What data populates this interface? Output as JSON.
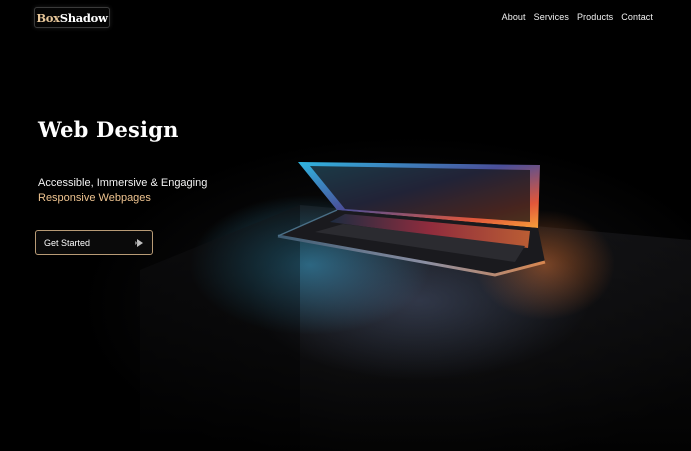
{
  "brand": {
    "logo_part1": "Box",
    "logo_part2": "Shadow"
  },
  "nav": {
    "items": [
      "About",
      "Services",
      "Products",
      "Contact"
    ]
  },
  "hero": {
    "title": "Web Design",
    "line1": "Accessible, Immersive & Engaging",
    "line2": "Responsive Webpages",
    "cta_label": "Get Started",
    "cta_icon": "arrow-right-icon",
    "accent_color": "#efc490"
  }
}
